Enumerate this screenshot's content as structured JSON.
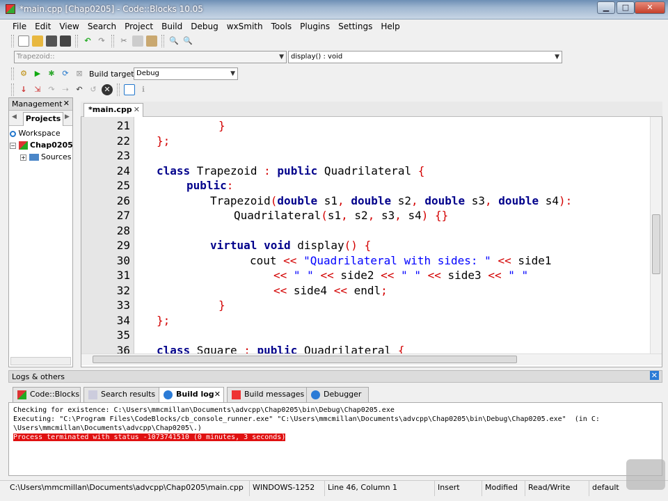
{
  "window": {
    "title": "*main.cpp [Chap0205] - Code::Blocks 10.05",
    "minimize": "▁",
    "maximize": "□",
    "close": "✕"
  },
  "menu": [
    "File",
    "Edit",
    "View",
    "Search",
    "Project",
    "Build",
    "Debug",
    "wxSmith",
    "Tools",
    "Plugins",
    "Settings",
    "Help"
  ],
  "scope": {
    "class_value": "Trapezoid::",
    "function_value": "display() : void"
  },
  "build": {
    "target_label": "Build target:",
    "target_value": "Debug"
  },
  "management": {
    "title": "Management",
    "tab": "Projects",
    "tree": {
      "workspace": "Workspace",
      "project": "Chap0205",
      "sources": "Sources"
    }
  },
  "editor": {
    "tab": "*main.cpp",
    "lines": [
      {
        "n": "21"
      },
      {
        "n": "22"
      },
      {
        "n": "23"
      },
      {
        "n": "24"
      },
      {
        "n": "25"
      },
      {
        "n": "26"
      },
      {
        "n": "27"
      },
      {
        "n": "28"
      },
      {
        "n": "29"
      },
      {
        "n": "30"
      },
      {
        "n": "31"
      },
      {
        "n": "32"
      },
      {
        "n": "33"
      },
      {
        "n": "34"
      },
      {
        "n": "35"
      },
      {
        "n": "36"
      }
    ]
  },
  "logs": {
    "title": "Logs & others",
    "tabs": [
      "Code::Blocks",
      "Search results",
      "Build log",
      "Build messages",
      "Debugger"
    ],
    "lines": [
      "Checking for existence: C:\\Users\\mmcmillan\\Documents\\advcpp\\Chap0205\\bin\\Debug\\Chap0205.exe",
      "Executing: \"C:\\Program Files\\CodeBlocks/cb_console_runner.exe\" \"C:\\Users\\mmcmillan\\Documents\\advcpp\\Chap0205\\bin\\Debug\\Chap0205.exe\"  (in C:",
      "\\Users\\mmcmillan\\Documents\\advcpp\\Chap0205\\.)",
      "Process terminated with status -1073741510 (0 minutes, 3 seconds)"
    ]
  },
  "status": {
    "path": "C:\\Users\\mmcmillan\\Documents\\advcpp\\Chap0205\\main.cpp",
    "encoding": "WINDOWS-1252",
    "position": "Line 46, Column 1",
    "mode": "Insert",
    "modified": "Modified",
    "rw": "Read/Write",
    "lang": "default"
  },
  "colors": {
    "keyword": "#00008b",
    "string": "#0000ff",
    "punct": "#d30000",
    "error_bg": "#e01010"
  }
}
